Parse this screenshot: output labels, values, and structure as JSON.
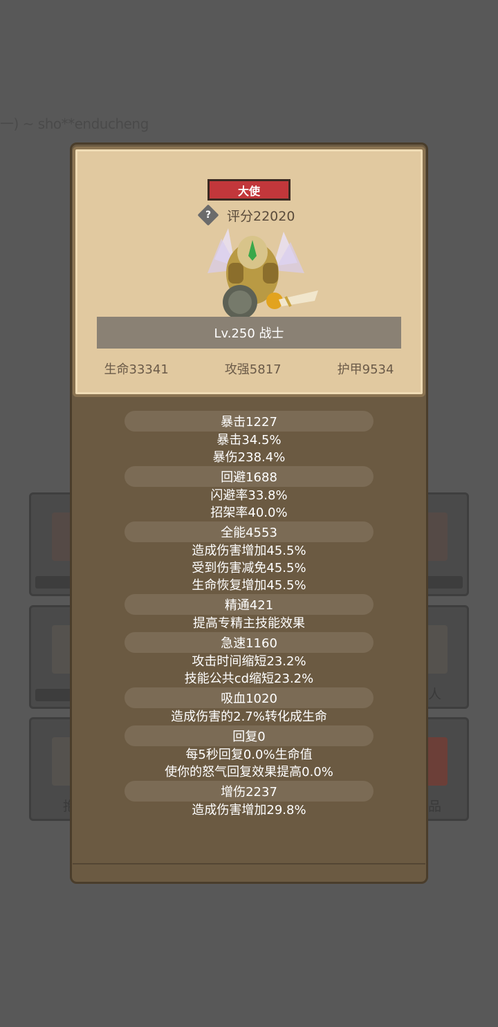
{
  "marquee": "一) ~ sho**enducheng",
  "bg_slots": {
    "left": [
      "",
      "",
      "抱"
    ],
    "right": [
      "",
      "人",
      "品"
    ]
  },
  "card": {
    "rank": "大使",
    "help_icon": "?",
    "score": "评分22020",
    "level": "Lv.250 战士",
    "stats": {
      "hp": "生命33341",
      "attack": "攻强5817",
      "armor": "护甲9534"
    }
  },
  "attributes": [
    {
      "header": "暴击1227",
      "details": [
        "暴击34.5%",
        "暴伤238.4%"
      ]
    },
    {
      "header": "回避1688",
      "details": [
        "闪避率33.8%",
        "招架率40.0%"
      ]
    },
    {
      "header": "全能4553",
      "details": [
        "造成伤害增加45.5%",
        "受到伤害减免45.5%",
        "生命恢复增加45.5%"
      ]
    },
    {
      "header": "精通421",
      "details": [
        "提高专精主技能效果"
      ]
    },
    {
      "header": "急速1160",
      "details": [
        "攻击时间缩短23.2%",
        "技能公共cd缩短23.2%"
      ]
    },
    {
      "header": "吸血1020",
      "details": [
        "造成伤害的2.7%转化成生命"
      ]
    },
    {
      "header": "回复0",
      "details": [
        "每5秒回复0.0%生命值",
        "使你的怒气回复效果提高0.0%"
      ]
    },
    {
      "header": "增伤2237",
      "details": [
        "造成伤害增加29.8%"
      ]
    }
  ]
}
